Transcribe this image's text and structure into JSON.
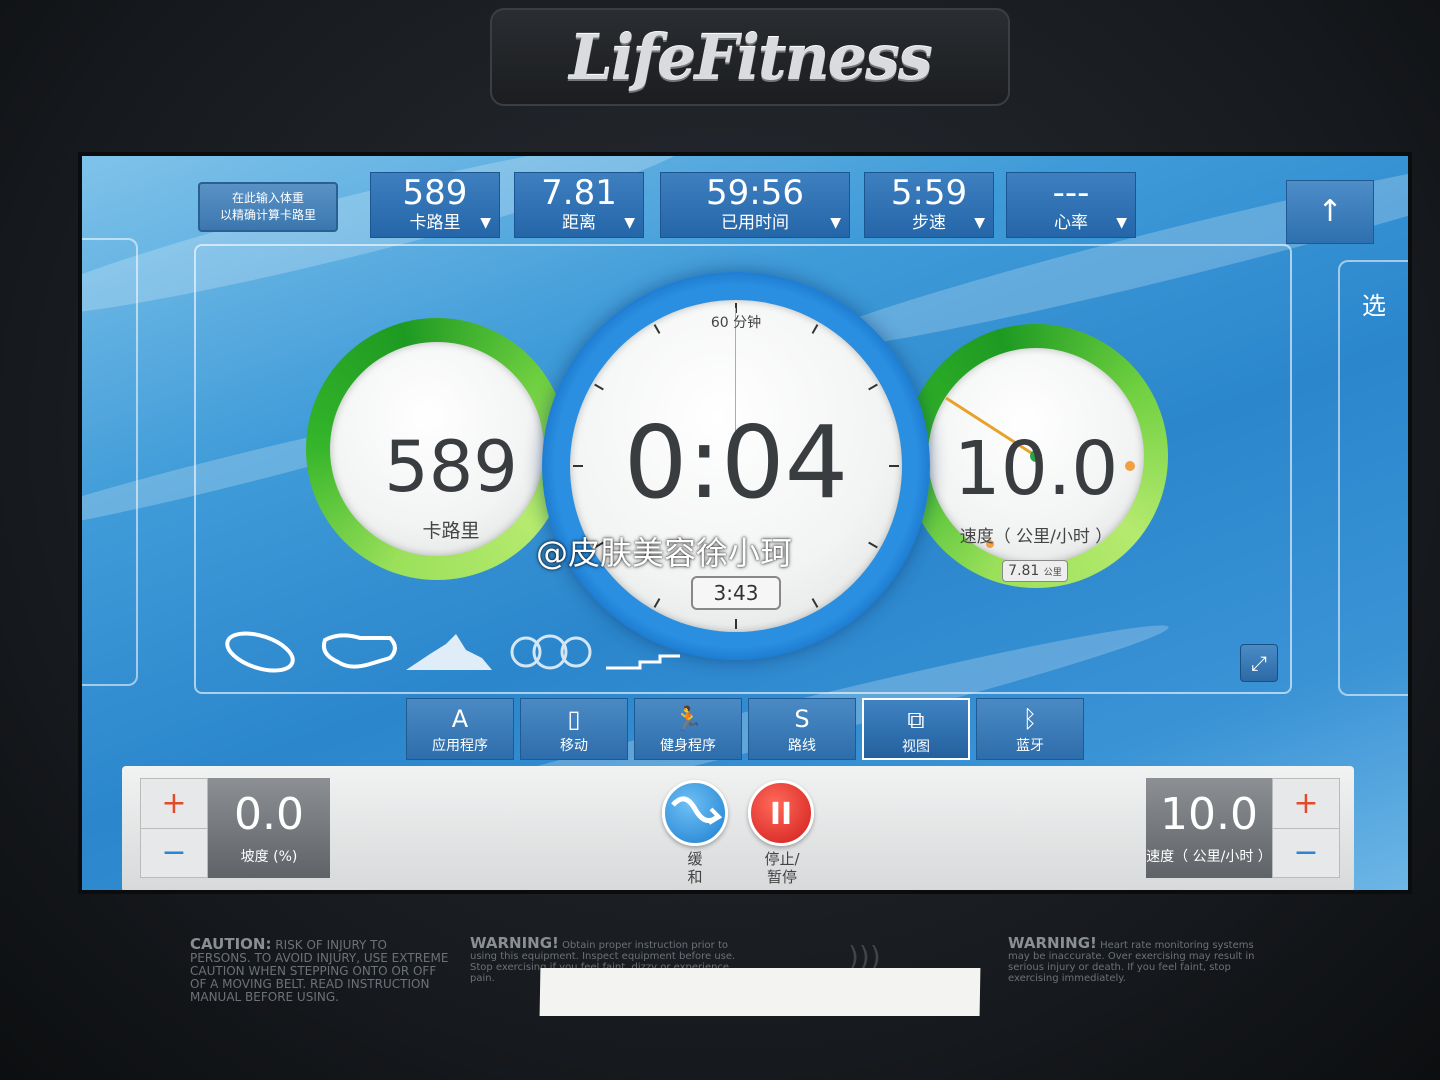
{
  "brand": "LifeFitness",
  "top_bar": {
    "weight_prompt": [
      "在此输入体重",
      "以精确计算卡路里"
    ],
    "stats": [
      {
        "value": "589",
        "label": "卡路里"
      },
      {
        "value": "7.81",
        "label": "距离"
      },
      {
        "value": "59:56",
        "label": "已用时间"
      },
      {
        "value": "5:59",
        "label": "步速"
      },
      {
        "value": "---",
        "label": "心率"
      }
    ],
    "scroll_up": "↑"
  },
  "right_panel_label": "选",
  "gauges": {
    "calories": {
      "value": "589",
      "label": "卡路里"
    },
    "timer": {
      "value": "0:04",
      "minute_label": "60 分钟",
      "elapsed": "3:43"
    },
    "speed": {
      "value": "10.0",
      "label": "速度（ 公里/小时 ）",
      "distance": "7.81",
      "distance_unit": "公里"
    }
  },
  "watermark": "@皮肤美容徐小珂",
  "nav": [
    {
      "label": "应用程序",
      "icon": "A"
    },
    {
      "label": "移动",
      "icon": "▯"
    },
    {
      "label": "健身程序",
      "icon": "🏃"
    },
    {
      "label": "路线",
      "icon": "S"
    },
    {
      "label": "视图",
      "icon": "⧉"
    },
    {
      "label": "蓝牙",
      "icon": "ᛒ"
    }
  ],
  "incline": {
    "value": "0.0",
    "label": "坡度 (%)",
    "plus": "+",
    "minus": "−"
  },
  "speed_control": {
    "value": "10.0",
    "label": "速度（ 公里/小时 ）",
    "plus": "+",
    "minus": "−"
  },
  "buttons": {
    "cooldown": {
      "label1": "缓",
      "label2": "和"
    },
    "pause": {
      "label1": "停止/",
      "label2": "暂停",
      "icon": "II"
    }
  },
  "warnings": {
    "caution_title": "CAUTION:",
    "caution_text": "RISK OF INJURY TO PERSONS. TO AVOID INJURY, USE EXTREME CAUTION WHEN STEPPING ONTO OR OFF OF A MOVING BELT. READ INSTRUCTION MANUAL BEFORE USING.",
    "warning1_title": "WARNING!",
    "warning1_text": "Obtain proper instruction prior to using this equipment. Inspect equipment before use. Stop exercising if you feel faint, dizzy or experience pain.",
    "warning2_title": "WARNING!",
    "warning2_text": "Heart rate monitoring systems may be inaccurate. Over exercising may result in serious injury or death. If you feel faint, stop exercising immediately."
  },
  "colors": {
    "accent_blue": "#2a8fe0",
    "green_ring": "#34b52a",
    "pause_red": "#e02a2a"
  }
}
